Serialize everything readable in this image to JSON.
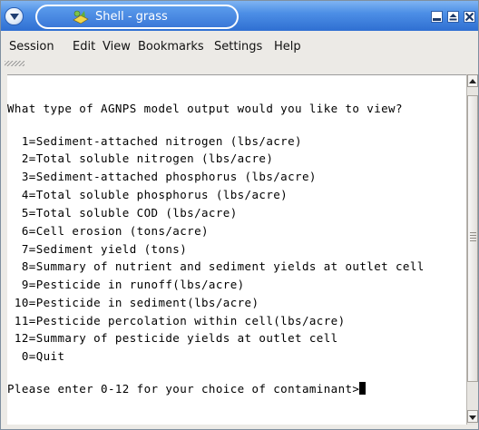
{
  "window": {
    "title": "Shell - grass",
    "icons": {
      "menu": "chevron-down-icon",
      "app": "terminal-shell-icon",
      "minimize": "minimize-icon",
      "maximize": "maximize-icon",
      "close": "close-icon"
    }
  },
  "menubar": {
    "items": [
      "Session",
      "Edit",
      "View",
      "Bookmarks",
      "Settings",
      "Help"
    ]
  },
  "terminal": {
    "question": "What type of AGNPS model output would you like to view?",
    "options": [
      "  1=Sediment-attached nitrogen (lbs/acre)",
      "  2=Total soluble nitrogen (lbs/acre)",
      "  3=Sediment-attached phosphorus (lbs/acre)",
      "  4=Total soluble phosphorus (lbs/acre)",
      "  5=Total soluble COD (lbs/acre)",
      "  6=Cell erosion (tons/acre)",
      "  7=Sediment yield (tons)",
      "  8=Summary of nutrient and sediment yields at outlet cell",
      "  9=Pesticide in runoff(lbs/acre)",
      " 10=Pesticide in sediment(lbs/acre)",
      " 11=Pesticide percolation within cell(lbs/acre)",
      " 12=Summary of pesticide yields at outlet cell",
      "  0=Quit"
    ],
    "prompt": "Please enter 0-12 for your choice of contaminant>"
  },
  "colors": {
    "titlebar": "#3a78d8",
    "menubar": "#eceae6",
    "terminal_bg": "#ffffff",
    "terminal_fg": "#000000"
  }
}
